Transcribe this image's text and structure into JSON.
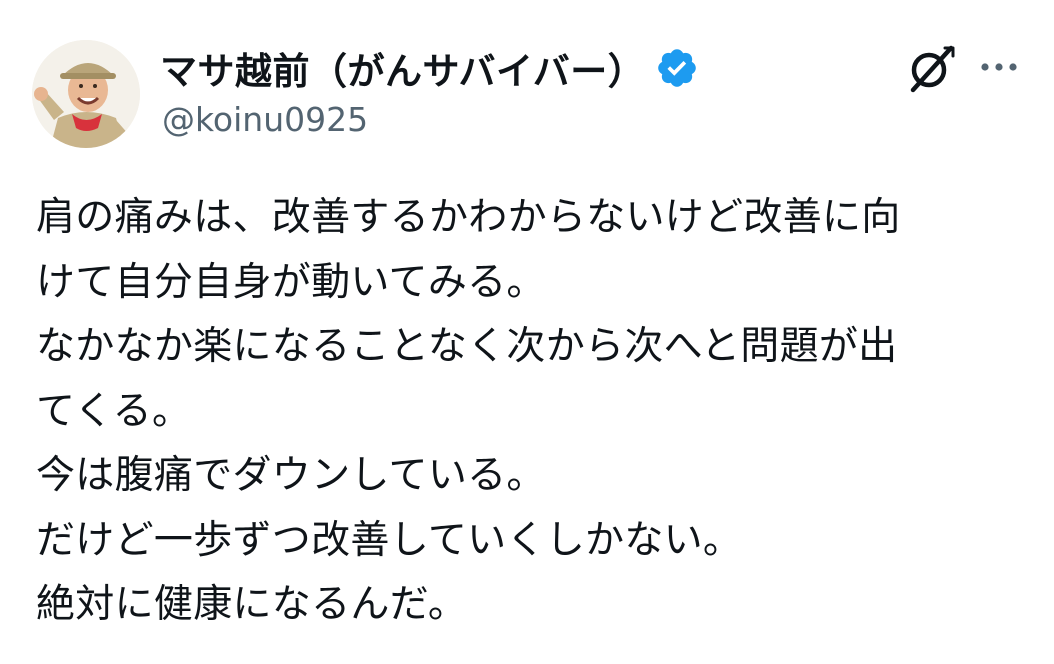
{
  "author": {
    "display_name": "マサ越前（がんサバイバー）",
    "handle": "@koinu0925",
    "verified": true,
    "verified_color": "#1d9bf0",
    "avatar_icon": "avatar-photo"
  },
  "actions": {
    "grok_icon": "grok-icon",
    "more_icon": "more-icon"
  },
  "tweet": {
    "lines": [
      "肩の痛みは、改善するかわからないけど改善に向",
      "けて自分自身が動いてみる。",
      "なかなか楽になることなく次から次へと問題が出",
      "てくる。",
      "今は腹痛でダウンしている。",
      "だけど一歩ずつ改善していくしかない。",
      "絶対に健康になるんだ。"
    ]
  },
  "colors": {
    "text_primary": "#0f1419",
    "text_secondary": "#536471",
    "background": "#ffffff"
  }
}
